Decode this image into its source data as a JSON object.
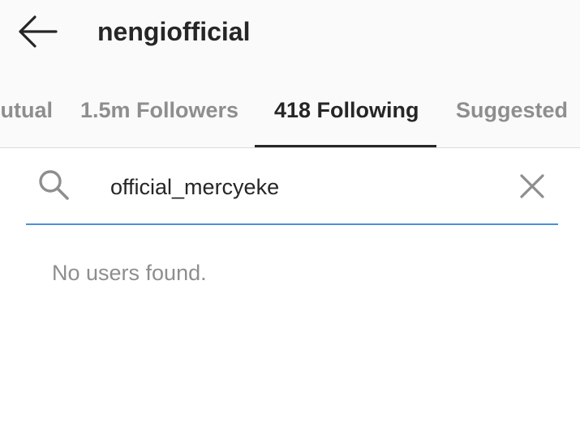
{
  "header": {
    "back_icon": "arrow-left-icon",
    "title": "nengiofficial"
  },
  "tabs": [
    {
      "label": "Mutual",
      "active": false
    },
    {
      "label": "1.5m Followers",
      "active": false
    },
    {
      "label": "418 Following",
      "active": true
    },
    {
      "label": "Suggested",
      "active": false
    }
  ],
  "search": {
    "icon": "search-icon",
    "value": "official_mercyeke",
    "clear_icon": "close-icon",
    "accent_color": "#4a90d9"
  },
  "results": {
    "empty_message": "No users found."
  },
  "colors": {
    "text_primary": "#262626",
    "text_secondary": "#8e8e8e",
    "header_background": "#fafafa"
  }
}
